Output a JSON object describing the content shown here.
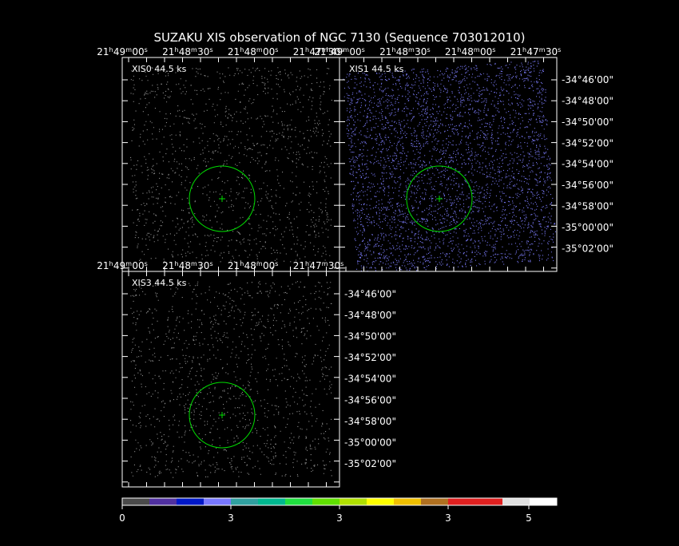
{
  "title": "SUZAKU XIS observation of NGC 7130  (Sequence 703012010)",
  "colors": {
    "background": "#000000",
    "frame": "#ffffff",
    "text": "#ffffff",
    "region": "#00dd00",
    "events": "#8a8aff"
  },
  "ra_ticks": [
    "21h49m00s",
    "21h48m30s",
    "21h48m00s",
    "21h47m30s"
  ],
  "dec_ticks": [
    "-34°46'00\"",
    "-34°48'00\"",
    "-34°50'00\"",
    "-34°52'00\"",
    "-34°54'00\"",
    "-34°56'00\"",
    "-34°58'00\"",
    "-35°00'00\"",
    "-35°02'00\""
  ],
  "panels": [
    {
      "id": "xis0",
      "label": "XIS0 44.5 ks",
      "show_dec_labels": false,
      "show_ra_top": true,
      "density": "low"
    },
    {
      "id": "xis1",
      "label": "XIS1 44.5 ks",
      "show_dec_labels": true,
      "show_ra_top": true,
      "density": "high"
    },
    {
      "id": "xis3",
      "label": "XIS3 44.5 ks",
      "show_dec_labels": true,
      "show_ra_top": true,
      "density": "low"
    }
  ],
  "colorbar": {
    "tick_labels": [
      "0",
      "3",
      "3",
      "3",
      "5"
    ],
    "segments": [
      "#4a4a4a",
      "#5030a0",
      "#0018c8",
      "#7878ff",
      "#30a0a0",
      "#00b890",
      "#20e040",
      "#60e000",
      "#b0e000",
      "#ffff00",
      "#f0c000",
      "#b07020",
      "#e02020",
      "#e02020",
      "#e0e0e0",
      "#ffffff"
    ]
  },
  "chart_data": {
    "type": "heatmap",
    "title": "SUZAKU XIS observation of NGC 7130  (Sequence 703012010)",
    "x_axis": {
      "label": "",
      "ticks": [
        "21h49m00s",
        "21h48m30s",
        "21h48m00s",
        "21h47m30s"
      ]
    },
    "y_axis": {
      "label": "",
      "ticks": [
        "-34°46'00\"",
        "-34°48'00\"",
        "-34°50'00\"",
        "-34°52'00\"",
        "-34°54'00\"",
        "-34°56'00\"",
        "-34°58'00\"",
        "-35°00'00\"",
        "-35°02'00\""
      ]
    },
    "panels": [
      "XIS0 44.5 ks",
      "XIS1 44.5 ks",
      "XIS3 44.5 ks"
    ],
    "exposure_ks": 44.5,
    "colorbar_ticks": [
      "0",
      "3",
      "3",
      "3",
      "5"
    ]
  }
}
